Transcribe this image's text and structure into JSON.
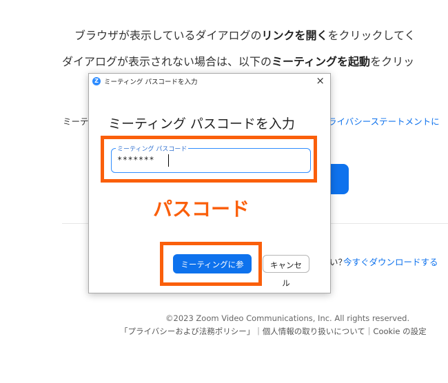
{
  "page": {
    "line1_pre": "ブラウザが表示しているダイアログの",
    "line1_bold": "リンクを開く",
    "line1_post": "をクリックしてく",
    "line2_pre": "ダイアログが表示されない場合は、以下の",
    "line2_bold": "ミーティングを起動",
    "line2_post": "をクリッ",
    "line3_prefix": "ミーテ",
    "privacy_link": "ライバシーステートメントに",
    "download_prefix": "い？",
    "download_link": "今すぐダウンロードする",
    "copyright": "©2023 Zoom Video Communications, Inc. All rights reserved.",
    "footer_links": "「プライバシーおよび法務ポリシー」｜個人情報の取り扱いについて｜Cookie の設定"
  },
  "dialog": {
    "logo_letter": "Z",
    "title": "ミーティング パスコードを入力",
    "close_glyph": "×",
    "heading": "ミーティング パスコードを入力",
    "field_label": "ミーティング パスコード",
    "field_value": "*******",
    "join_label": "ミーティングに参加",
    "cancel_label": "キャンセル"
  },
  "annotation": {
    "label": "パスコード",
    "color": "#fa5f0b"
  },
  "colors": {
    "brand_blue": "#0e72ed",
    "highlight": "#fa5f0b"
  }
}
